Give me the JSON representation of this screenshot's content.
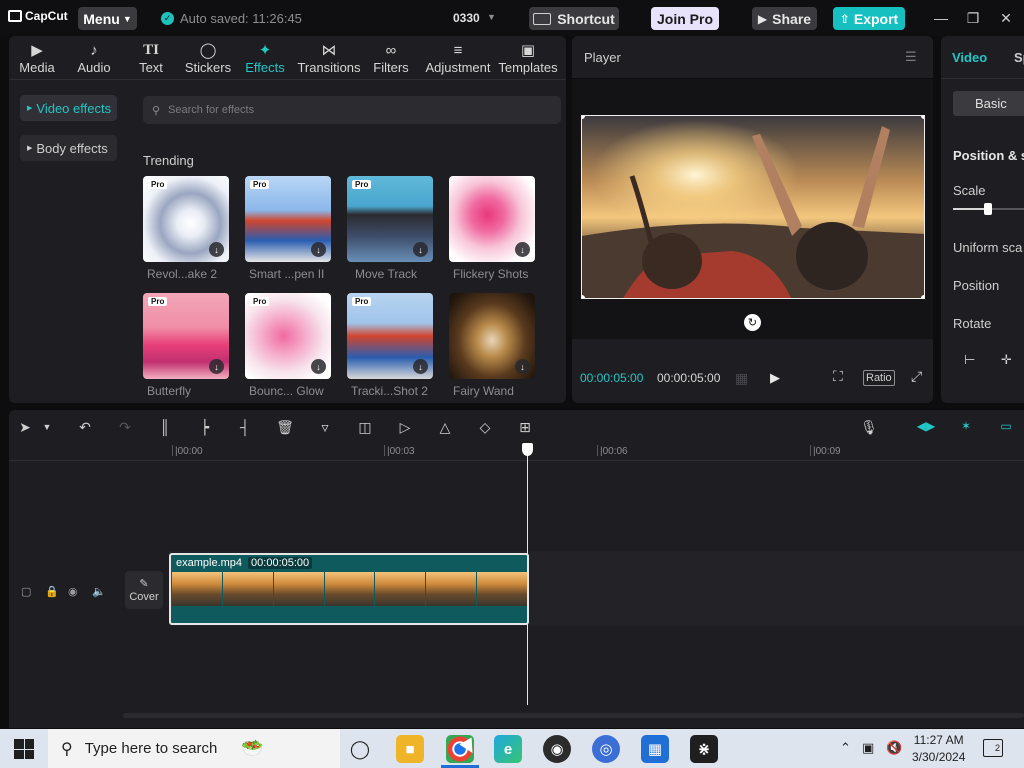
{
  "app": {
    "logo_text": "CapCut",
    "menu_label": "Menu",
    "autosave": "Auto saved: 11:26:45",
    "project_name": "0330",
    "shortcut_label": "Shortcut",
    "joinpro_label": "Join Pro",
    "share_label": "Share",
    "export_label": "Export"
  },
  "tabs": [
    {
      "label": "Media",
      "icon": "media-icon"
    },
    {
      "label": "Audio",
      "icon": "audio-icon"
    },
    {
      "label": "Text",
      "icon": "text-icon"
    },
    {
      "label": "Stickers",
      "icon": "stickers-icon"
    },
    {
      "label": "Effects",
      "icon": "effects-icon",
      "active": true
    },
    {
      "label": "Transitions",
      "icon": "transitions-icon"
    },
    {
      "label": "Filters",
      "icon": "filters-icon"
    },
    {
      "label": "Adjustment",
      "icon": "adjustment-icon"
    },
    {
      "label": "Templates",
      "icon": "templates-icon"
    }
  ],
  "sidebar": {
    "items": [
      {
        "label": "Video effects",
        "active": true
      },
      {
        "label": "Body effects",
        "active": false
      }
    ]
  },
  "search": {
    "placeholder": "Search for effects"
  },
  "trending_label": "Trending",
  "effects": [
    {
      "name": "Revol...ake 2",
      "pro": true,
      "pro_label": "Pro"
    },
    {
      "name": "Smart ...pen II",
      "pro": true,
      "pro_label": "Pro"
    },
    {
      "name": "Move Track",
      "pro": true,
      "pro_label": "Pro"
    },
    {
      "name": "Flickery Shots",
      "pro": false
    },
    {
      "name": "Butterfly",
      "pro": true,
      "pro_label": "Pro"
    },
    {
      "name": "Bounc... Glow",
      "pro": true,
      "pro_label": "Pro"
    },
    {
      "name": "Tracki...Shot 2",
      "pro": true,
      "pro_label": "Pro"
    },
    {
      "name": "Fairy Wand",
      "pro": false
    }
  ],
  "player": {
    "title": "Player",
    "current_time": "00:00:05:00",
    "total_time": "00:00:05:00",
    "ratio_label": "Ratio"
  },
  "right_panel": {
    "tab_video": "Video",
    "tab_speed": "Sp",
    "basic_label": "Basic",
    "section_title": "Position & s",
    "scale_label": "Scale",
    "uniform_label": "Uniform sca",
    "position_label": "Position",
    "rotate_label": "Rotate"
  },
  "timeline": {
    "ticks": [
      "|00:00",
      "|00:03",
      "|00:06",
      "|00:09"
    ],
    "cover_label": "Cover",
    "clip_name": "example.mp4",
    "clip_duration": "00:00:05:00"
  },
  "taskbar": {
    "search_placeholder": "Type here to search",
    "time": "11:27 AM",
    "date": "3/30/2024",
    "notifications": "2"
  },
  "colors": {
    "accent": "#22c6c4",
    "export": "#16bfc0",
    "joinpro": "#e9e2fb",
    "clip": "#0f5a5c"
  }
}
